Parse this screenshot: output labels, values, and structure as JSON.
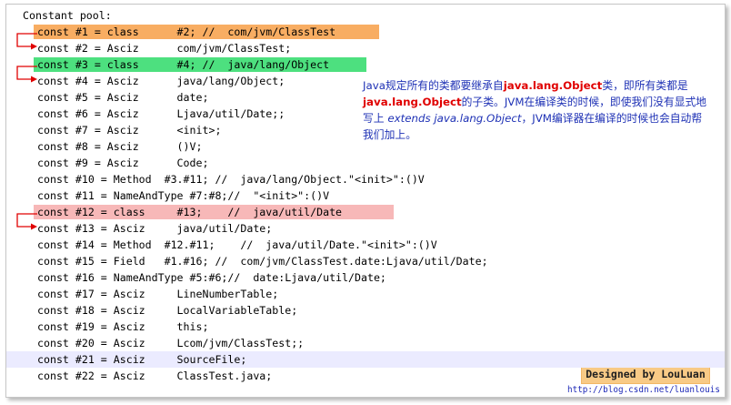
{
  "header": "Constant pool:",
  "lines": [
    "const #1 = class      #2; //  com/jvm/ClassTest",
    "const #2 = Asciz      com/jvm/ClassTest;",
    "const #3 = class      #4; //  java/lang/Object",
    "const #4 = Asciz      java/lang/Object;",
    "const #5 = Asciz      date;",
    "const #6 = Asciz      Ljava/util/Date;;",
    "const #7 = Asciz      <init>;",
    "const #8 = Asciz      ()V;",
    "const #9 = Asciz      Code;",
    "const #10 = Method  #3.#11; //  java/lang/Object.\"<init>\":()V",
    "const #11 = NameAndType #7:#8;//  \"<init>\":()V",
    "const #12 = class     #13;    //  java/util/Date",
    "const #13 = Asciz     java/util/Date;",
    "const #14 = Method  #12.#11;    //  java/util/Date.\"<init>\":()V",
    "const #15 = Field   #1.#16; //  com/jvm/ClassTest.date:Ljava/util/Date;",
    "const #16 = NameAndType #5:#6;//  date:Ljava/util/Date;",
    "const #17 = Asciz     LineNumberTable;",
    "const #18 = Asciz     LocalVariableTable;",
    "const #19 = Asciz     this;",
    "const #20 = Asciz     Lcom/jvm/ClassTest;;",
    "const #21 = Asciz     SourceFile;",
    "const #22 = Asciz     ClassTest.java;"
  ],
  "note": {
    "p1": "Java规定所有的类都要继承自",
    "k1": "java.lang.Object",
    "p2": "类，即所有类都是",
    "k2": "java.lang.Object",
    "p3": "的子类。JVM在编译类的时候，即使我们没有显式地写上 ",
    "code": "extends java.lang.Object",
    "p4": "，JVM编译器在编译的时候也会自动帮我们加上。"
  },
  "signature": "Designed by LouLuan",
  "url": "http://blog.csdn.net/luanlouis",
  "colors": {
    "orange_highlight": "#f8ad62",
    "green_highlight": "#4de07f",
    "pink_highlight": "#f7b8b8",
    "current_line": "#ebebff",
    "arrow": "#e00000",
    "note_text": "#1e31b5",
    "note_keyword": "#e00000"
  }
}
